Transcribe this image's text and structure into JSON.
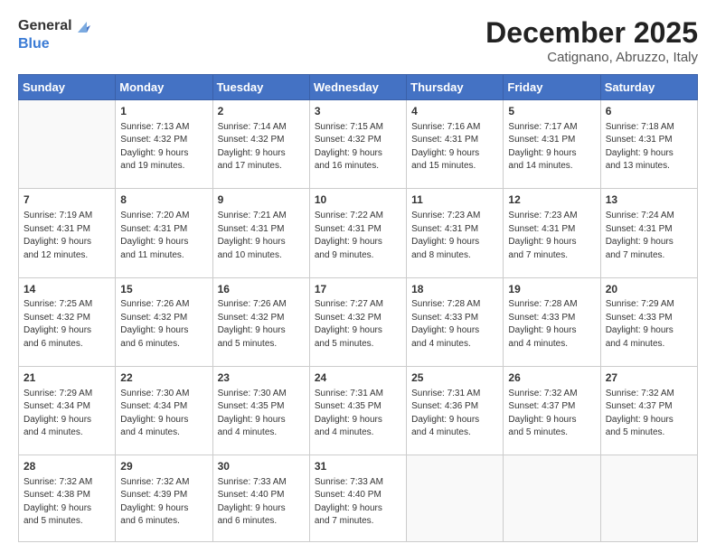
{
  "logo": {
    "general": "General",
    "blue": "Blue"
  },
  "title": {
    "month": "December 2025",
    "location": "Catignano, Abruzzo, Italy"
  },
  "headers": [
    "Sunday",
    "Monday",
    "Tuesday",
    "Wednesday",
    "Thursday",
    "Friday",
    "Saturday"
  ],
  "weeks": [
    [
      {
        "day": "",
        "info": ""
      },
      {
        "day": "1",
        "info": "Sunrise: 7:13 AM\nSunset: 4:32 PM\nDaylight: 9 hours\nand 19 minutes."
      },
      {
        "day": "2",
        "info": "Sunrise: 7:14 AM\nSunset: 4:32 PM\nDaylight: 9 hours\nand 17 minutes."
      },
      {
        "day": "3",
        "info": "Sunrise: 7:15 AM\nSunset: 4:32 PM\nDaylight: 9 hours\nand 16 minutes."
      },
      {
        "day": "4",
        "info": "Sunrise: 7:16 AM\nSunset: 4:31 PM\nDaylight: 9 hours\nand 15 minutes."
      },
      {
        "day": "5",
        "info": "Sunrise: 7:17 AM\nSunset: 4:31 PM\nDaylight: 9 hours\nand 14 minutes."
      },
      {
        "day": "6",
        "info": "Sunrise: 7:18 AM\nSunset: 4:31 PM\nDaylight: 9 hours\nand 13 minutes."
      }
    ],
    [
      {
        "day": "7",
        "info": "Sunrise: 7:19 AM\nSunset: 4:31 PM\nDaylight: 9 hours\nand 12 minutes."
      },
      {
        "day": "8",
        "info": "Sunrise: 7:20 AM\nSunset: 4:31 PM\nDaylight: 9 hours\nand 11 minutes."
      },
      {
        "day": "9",
        "info": "Sunrise: 7:21 AM\nSunset: 4:31 PM\nDaylight: 9 hours\nand 10 minutes."
      },
      {
        "day": "10",
        "info": "Sunrise: 7:22 AM\nSunset: 4:31 PM\nDaylight: 9 hours\nand 9 minutes."
      },
      {
        "day": "11",
        "info": "Sunrise: 7:23 AM\nSunset: 4:31 PM\nDaylight: 9 hours\nand 8 minutes."
      },
      {
        "day": "12",
        "info": "Sunrise: 7:23 AM\nSunset: 4:31 PM\nDaylight: 9 hours\nand 7 minutes."
      },
      {
        "day": "13",
        "info": "Sunrise: 7:24 AM\nSunset: 4:31 PM\nDaylight: 9 hours\nand 7 minutes."
      }
    ],
    [
      {
        "day": "14",
        "info": "Sunrise: 7:25 AM\nSunset: 4:32 PM\nDaylight: 9 hours\nand 6 minutes."
      },
      {
        "day": "15",
        "info": "Sunrise: 7:26 AM\nSunset: 4:32 PM\nDaylight: 9 hours\nand 6 minutes."
      },
      {
        "day": "16",
        "info": "Sunrise: 7:26 AM\nSunset: 4:32 PM\nDaylight: 9 hours\nand 5 minutes."
      },
      {
        "day": "17",
        "info": "Sunrise: 7:27 AM\nSunset: 4:32 PM\nDaylight: 9 hours\nand 5 minutes."
      },
      {
        "day": "18",
        "info": "Sunrise: 7:28 AM\nSunset: 4:33 PM\nDaylight: 9 hours\nand 4 minutes."
      },
      {
        "day": "19",
        "info": "Sunrise: 7:28 AM\nSunset: 4:33 PM\nDaylight: 9 hours\nand 4 minutes."
      },
      {
        "day": "20",
        "info": "Sunrise: 7:29 AM\nSunset: 4:33 PM\nDaylight: 9 hours\nand 4 minutes."
      }
    ],
    [
      {
        "day": "21",
        "info": "Sunrise: 7:29 AM\nSunset: 4:34 PM\nDaylight: 9 hours\nand 4 minutes."
      },
      {
        "day": "22",
        "info": "Sunrise: 7:30 AM\nSunset: 4:34 PM\nDaylight: 9 hours\nand 4 minutes."
      },
      {
        "day": "23",
        "info": "Sunrise: 7:30 AM\nSunset: 4:35 PM\nDaylight: 9 hours\nand 4 minutes."
      },
      {
        "day": "24",
        "info": "Sunrise: 7:31 AM\nSunset: 4:35 PM\nDaylight: 9 hours\nand 4 minutes."
      },
      {
        "day": "25",
        "info": "Sunrise: 7:31 AM\nSunset: 4:36 PM\nDaylight: 9 hours\nand 4 minutes."
      },
      {
        "day": "26",
        "info": "Sunrise: 7:32 AM\nSunset: 4:37 PM\nDaylight: 9 hours\nand 5 minutes."
      },
      {
        "day": "27",
        "info": "Sunrise: 7:32 AM\nSunset: 4:37 PM\nDaylight: 9 hours\nand 5 minutes."
      }
    ],
    [
      {
        "day": "28",
        "info": "Sunrise: 7:32 AM\nSunset: 4:38 PM\nDaylight: 9 hours\nand 5 minutes."
      },
      {
        "day": "29",
        "info": "Sunrise: 7:32 AM\nSunset: 4:39 PM\nDaylight: 9 hours\nand 6 minutes."
      },
      {
        "day": "30",
        "info": "Sunrise: 7:33 AM\nSunset: 4:40 PM\nDaylight: 9 hours\nand 6 minutes."
      },
      {
        "day": "31",
        "info": "Sunrise: 7:33 AM\nSunset: 4:40 PM\nDaylight: 9 hours\nand 7 minutes."
      },
      {
        "day": "",
        "info": ""
      },
      {
        "day": "",
        "info": ""
      },
      {
        "day": "",
        "info": ""
      }
    ]
  ]
}
